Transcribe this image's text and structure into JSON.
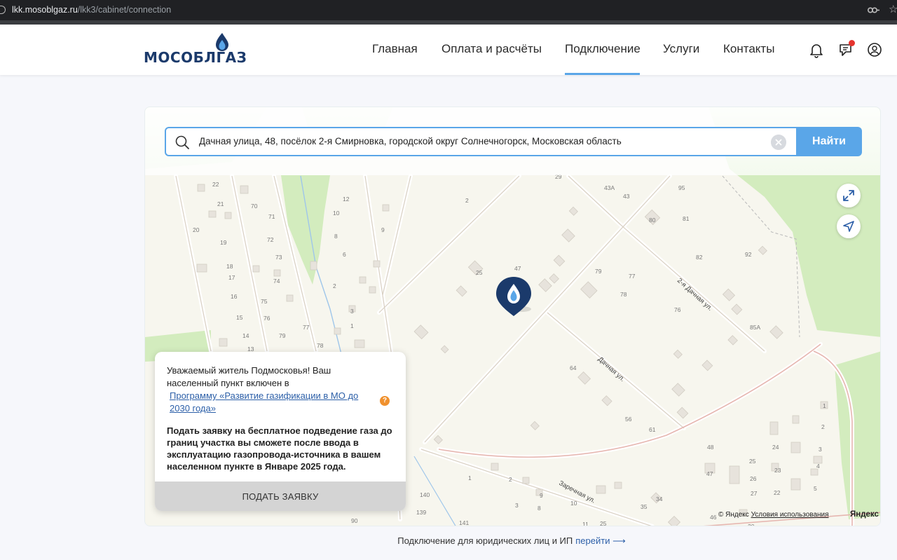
{
  "browser": {
    "url_host": "lkk.mosoblgaz.ru",
    "url_path": "/lkk3/cabinet/connection"
  },
  "header": {
    "logo_text": "МОСОБЛГАЗ",
    "nav": [
      {
        "label": "Главная",
        "active": false
      },
      {
        "label": "Оплата и расчёты",
        "active": false
      },
      {
        "label": "Подключение",
        "active": true
      },
      {
        "label": "Услуги",
        "active": false
      },
      {
        "label": "Контакты",
        "active": false
      }
    ],
    "accent_color": "#5aa6e8"
  },
  "search": {
    "value": "Дачная улица, 48, посёлок 2-я Смирновка, городской округ Солнечногорск, Московская область",
    "button_label": "Найти"
  },
  "map": {
    "street_labels": [
      "2-я Дачная ул.",
      "Дачная ул.",
      "Заречная ул."
    ],
    "house_numbers": [
      "22",
      "21",
      "70",
      "71",
      "20",
      "19",
      "72",
      "73",
      "18",
      "17",
      "74",
      "16",
      "75",
      "15",
      "76",
      "14",
      "79",
      "77",
      "78",
      "13",
      "12",
      "10",
      "8",
      "6",
      "9",
      "2",
      "3",
      "1",
      "2",
      "25",
      "47",
      "29",
      "43А",
      "43",
      "95",
      "80",
      "81",
      "82",
      "92",
      "79",
      "77",
      "78",
      "76",
      "85А",
      "64",
      "56",
      "61",
      "1",
      "2",
      "3",
      "4",
      "5",
      "48",
      "24",
      "25",
      "23",
      "26",
      "22",
      "47",
      "27",
      "140",
      "139",
      "141",
      "90",
      "1",
      "2",
      "3",
      "8",
      "9",
      "10",
      "11",
      "25",
      "35",
      "34",
      "46",
      "20"
    ],
    "copyright": "© Яндекс",
    "terms_link": "Условия использования",
    "yandex_logo": "Яндекс"
  },
  "info_panel": {
    "message": "Уважаемый житель Подмосковья! Ваш населенный пункт включен в",
    "program_link": "Программу «Развитие газификации в МО до 2030 года»",
    "help_icon": "?",
    "apply_note": "Подать заявку на бесплатное подведение газа до границ участка вы сможете после ввода в эксплуатацию газопровода-источника в вашем населенном пункте в Январе 2025 года.",
    "apply_button": "ПОДАТЬ ЗАЯВКУ"
  },
  "footer": {
    "text": "Подключение для юридических лиц и ИП",
    "link": "перейти ⟶"
  },
  "icons": [
    "site-info-icon",
    "key-icon",
    "star-icon",
    "flame-icon",
    "bell-icon",
    "chat-icon",
    "user-icon",
    "search-icon",
    "clear-icon",
    "expand-icon",
    "locate-icon",
    "location-pin-icon"
  ]
}
